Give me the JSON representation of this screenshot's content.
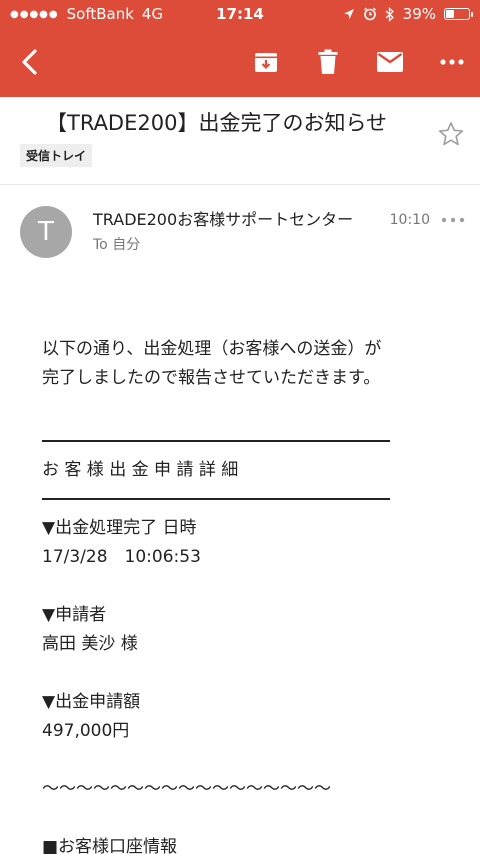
{
  "status_bar": {
    "signal_dots": "●●●●●",
    "carrier": "SoftBank",
    "network": "4G",
    "time": "17:14",
    "battery_percent": "39%",
    "battery_level": 0.39,
    "icons": [
      "location-icon",
      "alarm-icon",
      "bluetooth-icon",
      "battery-icon"
    ]
  },
  "toolbar": {
    "background_color": "#dd4b39",
    "buttons": [
      "back-icon",
      "archive-icon",
      "trash-icon",
      "mail-icon",
      "more-icon"
    ]
  },
  "email": {
    "subject": "【TRADE200】出金完了のお知らせ",
    "label": "受信トレイ",
    "sender": {
      "avatar_initial": "T",
      "name": "TRADE200お客様サポートセンター",
      "to": "To 自分",
      "time": "10:10"
    },
    "body": {
      "intro_line1": "以下の通り、出金処理（お客様への送金）が",
      "intro_line2": "完了しましたので報告させていただきます。",
      "details_heading": "お 客 様 出 金 申 請 詳 細",
      "completed_label": "▼出金処理完了 日時",
      "completed_value": "17/3/28　10:06:53",
      "applicant_label": "▼申請者",
      "applicant_value": "高田 美沙 様",
      "amount_label": "▼出金申請額",
      "amount_value": "497,000円",
      "wave_separator": "〜〜〜〜〜〜〜〜〜〜〜〜〜〜〜〜〜",
      "account_heading": "■お客様口座情報"
    }
  }
}
